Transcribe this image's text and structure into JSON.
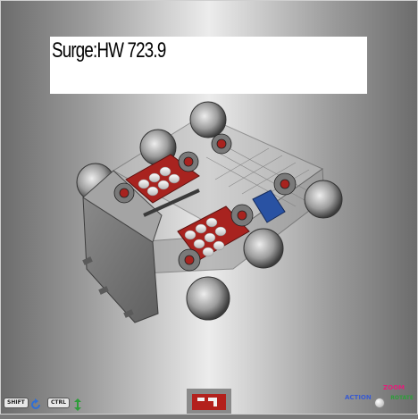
{
  "robot": {
    "name_label": "Surge:HW 723.9"
  },
  "controls": {
    "shift_label": "SHIFT",
    "ctrl_label": "CTRL",
    "zoom_label": "ZOOM",
    "action_label": "ACTION",
    "rotate_label": "ROTATE"
  },
  "colors": {
    "accent_zoom": "#e0207a",
    "accent_action": "#3a5bd0",
    "accent_rotate": "#2e9d3a",
    "chassis_red": "#a8231f",
    "motor_blue": "#2952a3"
  },
  "icons": [
    "rotate-arrow-icon",
    "move-vertical-icon",
    "logo-icon",
    "rotate-knob-icon"
  ]
}
